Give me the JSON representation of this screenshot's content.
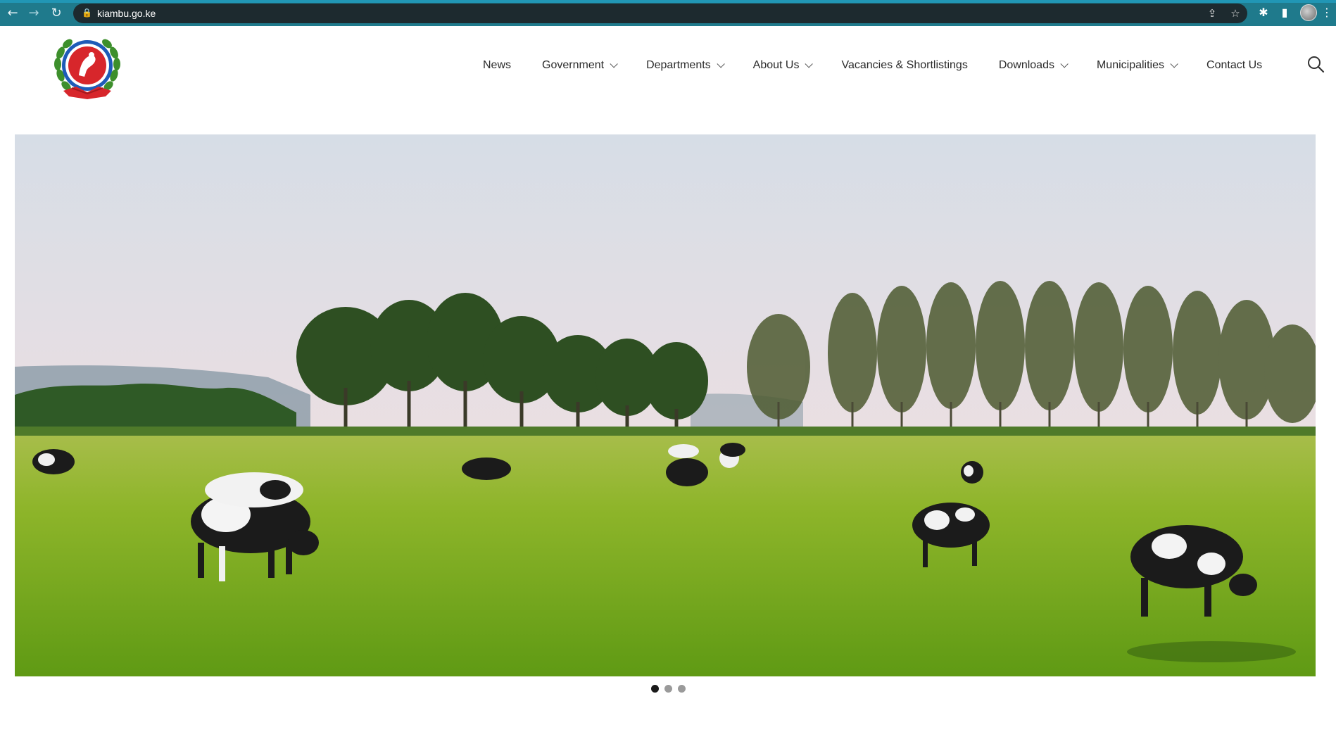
{
  "browser": {
    "url": "kiambu.go.ke",
    "icons": [
      "back-arrow-icon",
      "forward-arrow-icon",
      "reload-icon",
      "lock-icon",
      "share-icon",
      "star-icon",
      "extensions-icon",
      "sidepanel-icon",
      "profile-avatar",
      "menu-kebab-icon"
    ]
  },
  "header": {
    "logo_alt": "County Government of Kiambu seal",
    "nav": [
      {
        "label": "News",
        "dropdown": false
      },
      {
        "label": "Government",
        "dropdown": true
      },
      {
        "label": "Departments",
        "dropdown": true
      },
      {
        "label": "About Us",
        "dropdown": true
      },
      {
        "label": "Vacancies & Shortlistings",
        "dropdown": false
      },
      {
        "label": "Downloads",
        "dropdown": true
      },
      {
        "label": "Municipalities",
        "dropdown": true
      },
      {
        "label": "Contact Us",
        "dropdown": false
      }
    ]
  },
  "hero": {
    "image_subject": "cows grazing on green pasture with tree line",
    "slides_total": 3,
    "active_slide": 1
  },
  "colors": {
    "browser_bar": "#1f7a8c",
    "omnibox": "#1d2a2f",
    "nav_text": "#2b2b2b",
    "dot_active": "#1a1a1a",
    "dot_inactive": "#9a9a9a"
  }
}
